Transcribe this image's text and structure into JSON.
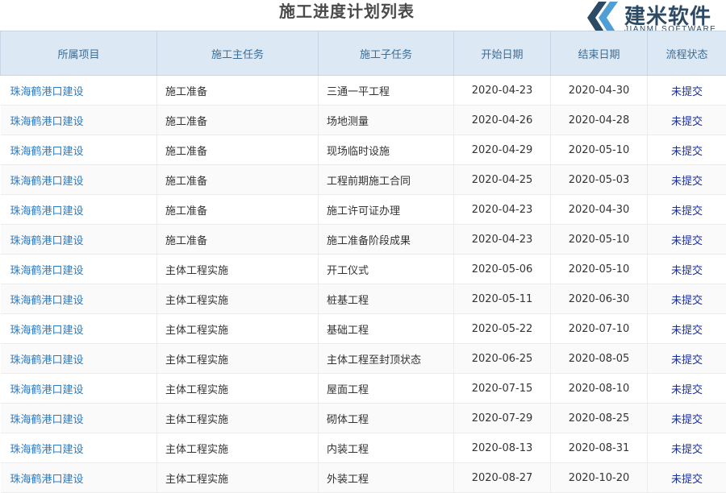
{
  "page": {
    "title": "施工进度计划列表"
  },
  "brand": {
    "name_cn": "建米软件",
    "name_en": "JIANMI SOFTWARE",
    "color": "#2c4a63"
  },
  "table": {
    "columns": [
      "所属项目",
      "施工主任务",
      "施工子任务",
      "开始日期",
      "结束日期",
      "流程状态"
    ],
    "rows": [
      [
        "珠海鹤港口建设",
        "施工准备",
        "三通一平工程",
        "2020-04-23",
        "2020-04-30",
        "未提交"
      ],
      [
        "珠海鹤港口建设",
        "施工准备",
        "场地测量",
        "2020-04-26",
        "2020-04-28",
        "未提交"
      ],
      [
        "珠海鹤港口建设",
        "施工准备",
        "现场临时设施",
        "2020-04-29",
        "2020-05-10",
        "未提交"
      ],
      [
        "珠海鹤港口建设",
        "施工准备",
        "工程前期施工合同",
        "2020-04-25",
        "2020-05-03",
        "未提交"
      ],
      [
        "珠海鹤港口建设",
        "施工准备",
        "施工许可证办理",
        "2020-04-23",
        "2020-04-30",
        "未提交"
      ],
      [
        "珠海鹤港口建设",
        "施工准备",
        "施工准备阶段成果",
        "2020-04-23",
        "2020-05-10",
        "未提交"
      ],
      [
        "珠海鹤港口建设",
        "主体工程实施",
        "开工仪式",
        "2020-05-06",
        "2020-05-10",
        "未提交"
      ],
      [
        "珠海鹤港口建设",
        "主体工程实施",
        "桩基工程",
        "2020-05-11",
        "2020-06-30",
        "未提交"
      ],
      [
        "珠海鹤港口建设",
        "主体工程实施",
        "基础工程",
        "2020-05-22",
        "2020-07-10",
        "未提交"
      ],
      [
        "珠海鹤港口建设",
        "主体工程实施",
        "主体工程至封顶状态",
        "2020-06-25",
        "2020-08-05",
        "未提交"
      ],
      [
        "珠海鹤港口建设",
        "主体工程实施",
        "屋面工程",
        "2020-07-15",
        "2020-08-10",
        "未提交"
      ],
      [
        "珠海鹤港口建设",
        "主体工程实施",
        "砌体工程",
        "2020-07-29",
        "2020-08-25",
        "未提交"
      ],
      [
        "珠海鹤港口建设",
        "主体工程实施",
        "内装工程",
        "2020-08-13",
        "2020-08-31",
        "未提交"
      ],
      [
        "珠海鹤港口建设",
        "主体工程实施",
        "外装工程",
        "2020-08-27",
        "2020-10-20",
        "未提交"
      ]
    ]
  }
}
